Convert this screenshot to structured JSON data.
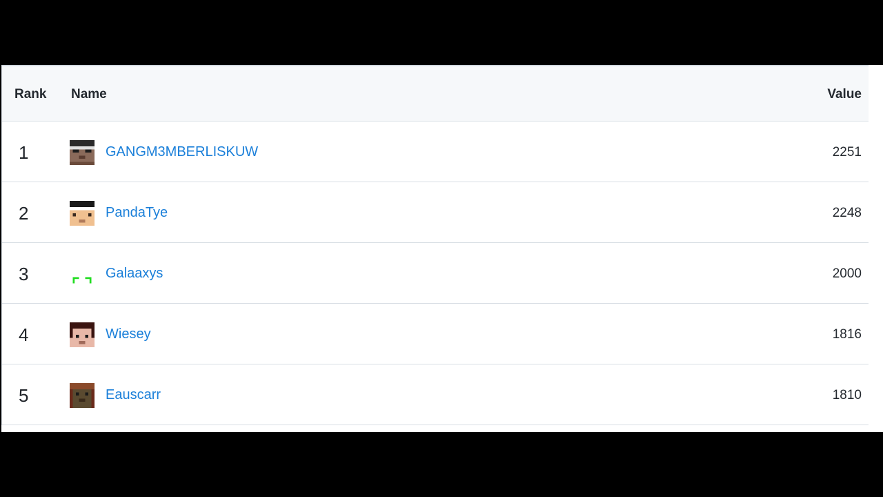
{
  "table": {
    "headers": {
      "rank": "Rank",
      "name": "Name",
      "value": "Value"
    },
    "rows": [
      {
        "rank": "1",
        "name": "GANGM3MBERLISKUW",
        "value": "2251",
        "avatar": "steve-head-sunglasses-icon"
      },
      {
        "rank": "2",
        "name": "PandaTye",
        "value": "2248",
        "avatar": "steve-head-headband-icon"
      },
      {
        "rank": "3",
        "name": "Galaaxys",
        "value": "2000",
        "avatar": "green-bracket-head-icon"
      },
      {
        "rank": "4",
        "name": "Wiesey",
        "value": "1816",
        "avatar": "steve-head-dark-hair-icon"
      },
      {
        "rank": "5",
        "name": "Eauscarr",
        "value": "1810",
        "avatar": "steve-head-brown-icon"
      }
    ]
  },
  "colors": {
    "link": "#1a7fd9",
    "header_bg": "#f6f8fa",
    "border": "#d8dee4",
    "letterbox": "#000000"
  }
}
